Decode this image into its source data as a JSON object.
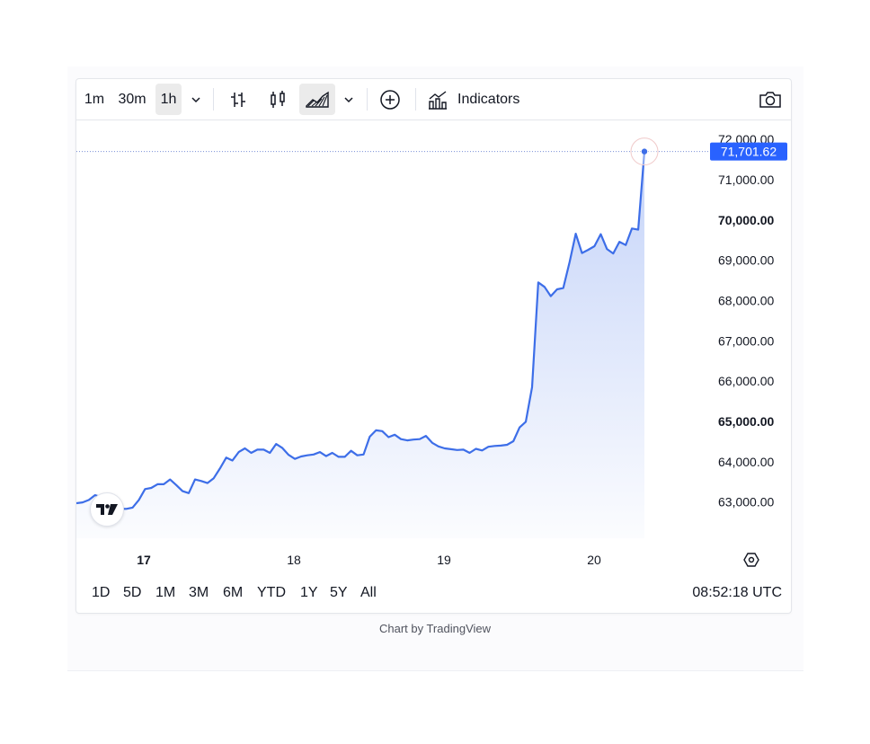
{
  "toolbar": {
    "intervals": [
      "1m",
      "30m",
      "1h"
    ],
    "active_interval": "1h",
    "indicators_label": "Indicators"
  },
  "chart_data": {
    "type": "area",
    "x_tick_labels": [
      "17",
      "18",
      "19",
      "20"
    ],
    "y_tick_labels": [
      "72,000.00",
      "71,000.00",
      "70,000.00",
      "69,000.00",
      "68,000.00",
      "67,000.00",
      "66,000.00",
      "65,000.00",
      "64,000.00",
      "63,000.00"
    ],
    "ylim": [
      62100,
      72250
    ],
    "last_price_label": "71,701.62",
    "last_price": 71701.62,
    "line_color": "#3d6ee8",
    "label_bg": "#2962ff",
    "series": [
      {
        "values": [
          62970,
          62990,
          63050,
          63170,
          63120,
          62860,
          62840,
          62830,
          62830,
          62860,
          63050,
          63320,
          63350,
          63440,
          63440,
          63560,
          63420,
          63270,
          63220,
          63560,
          63520,
          63470,
          63590,
          63830,
          64100,
          64030,
          64240,
          64330,
          64220,
          64300,
          64300,
          64220,
          64440,
          64340,
          64170,
          64070,
          64130,
          64160,
          64180,
          64240,
          64140,
          64220,
          64120,
          64120,
          64270,
          64160,
          64180,
          64620,
          64780,
          64760,
          64610,
          64670,
          64560,
          64530,
          64550,
          64560,
          64640,
          64470,
          64380,
          64330,
          64310,
          64290,
          64300,
          64220,
          64320,
          64280,
          64370,
          64390,
          64400,
          64420,
          64510,
          64850,
          64990,
          65850,
          68450,
          68340,
          68110,
          68280,
          68310,
          68950,
          69660,
          69180,
          69260,
          69350,
          69650,
          69280,
          69170,
          69460,
          69380,
          69790,
          69760,
          71701.62
        ]
      }
    ]
  },
  "bottombar": {
    "ranges": [
      "1D",
      "5D",
      "1M",
      "3M",
      "6M",
      "YTD",
      "1Y",
      "5Y",
      "All"
    ],
    "time": "08:52:18 UTC"
  },
  "credit": "Chart by TradingView"
}
